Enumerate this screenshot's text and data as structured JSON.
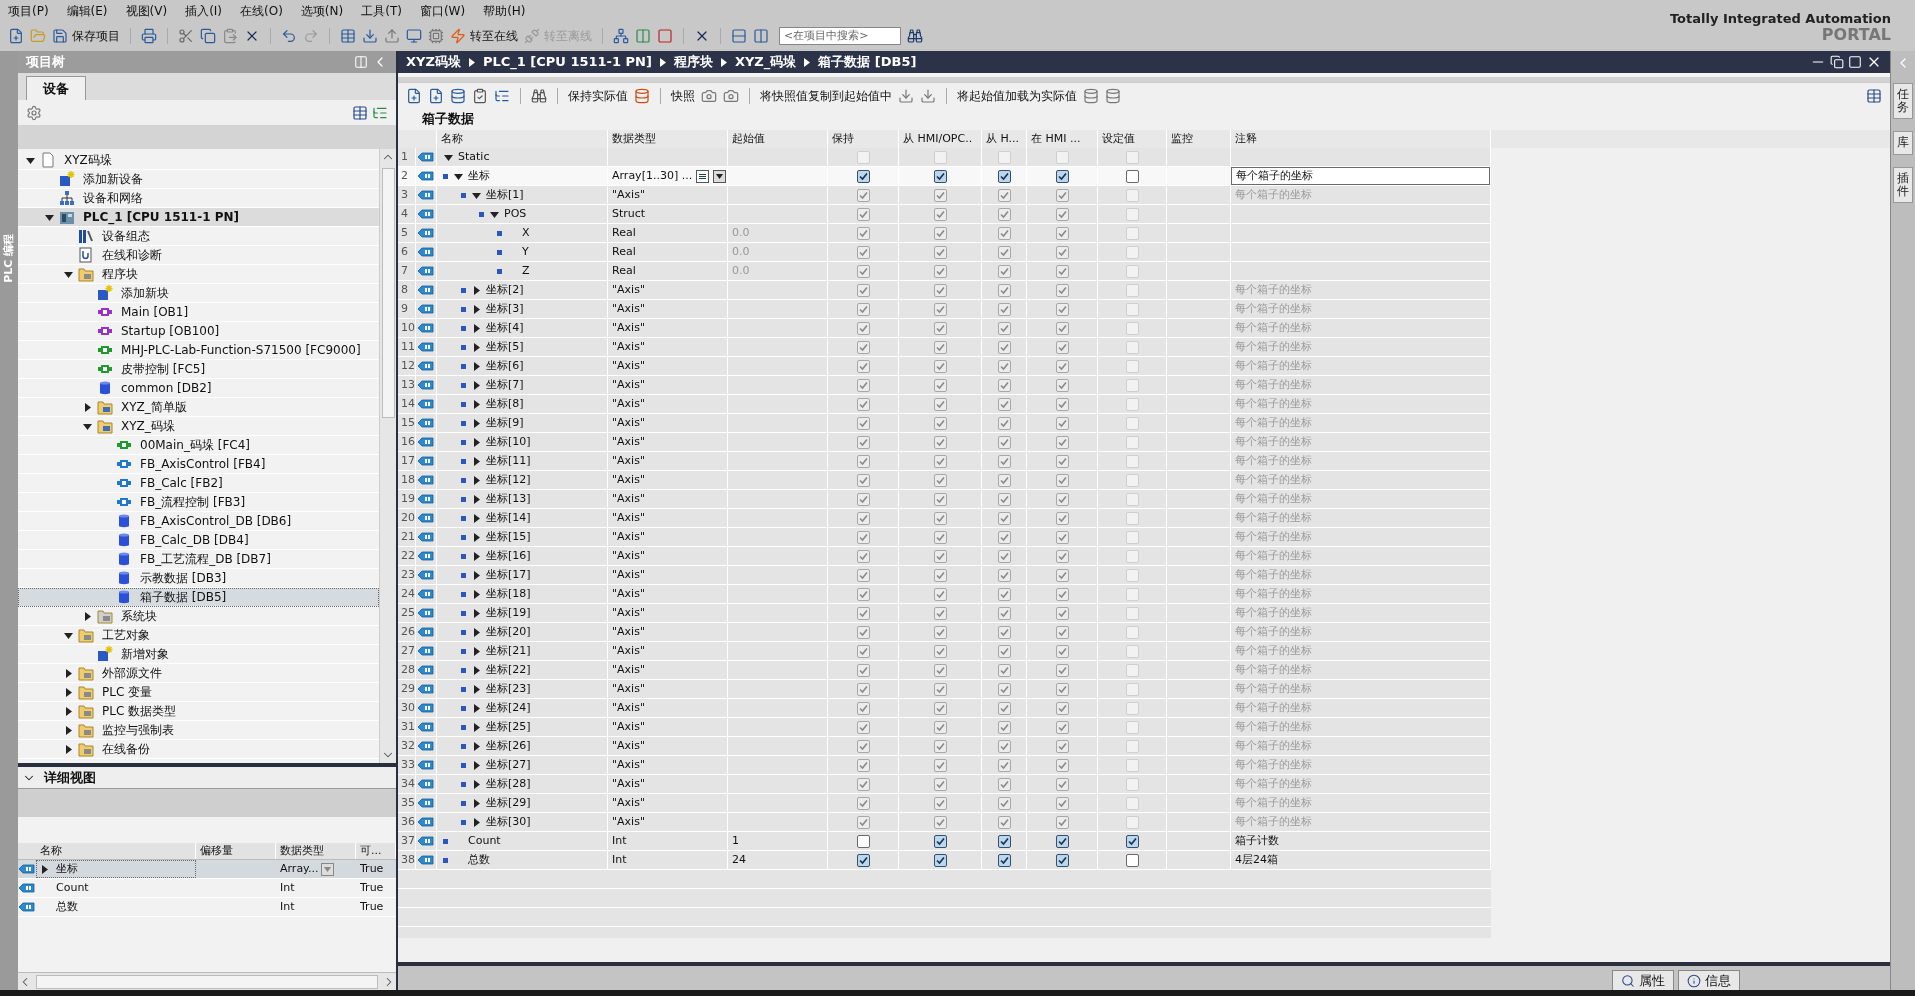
{
  "menu": [
    "项目(P)",
    "编辑(E)",
    "视图(V)",
    "插入(I)",
    "在线(O)",
    "选项(N)",
    "工具(T)",
    "窗口(W)",
    "帮助(H)"
  ],
  "toolbar": {
    "save_label": "保存项目",
    "go_online": {
      "label": "转至在线",
      "disabled": false
    },
    "go_offline": {
      "label": "转至离线",
      "disabled": true
    },
    "search_placeholder": "<在项目中搜索>"
  },
  "brand": {
    "line1": "Totally Integrated Automation",
    "line2": "PORTAL"
  },
  "left_strip": "PLC 编程",
  "project_tree": {
    "title": "项目树",
    "tab": "设备",
    "items": [
      {
        "label": "XYZ码垛",
        "kind": "doc",
        "expanded": true,
        "selected": false,
        "active": false,
        "children": [
          {
            "label": "添加新设备",
            "kind": "add",
            "selected": false,
            "active": false
          },
          {
            "label": "设备和网络",
            "kind": "network",
            "selected": false,
            "active": false
          },
          {
            "label": "PLC_1 [CPU 1511-1 PN]",
            "kind": "plc",
            "expanded": true,
            "selected": false,
            "active": true,
            "children": [
              {
                "label": "设备组态",
                "kind": "config",
                "selected": false,
                "active": false
              },
              {
                "label": "在线和诊断",
                "kind": "diag",
                "selected": false,
                "active": false
              },
              {
                "label": "程序块",
                "kind": "folder",
                "expanded": true,
                "selected": false,
                "active": false,
                "children": [
                  {
                    "label": "添加新块",
                    "kind": "add",
                    "selected": false,
                    "active": false
                  },
                  {
                    "label": "Main [OB1]",
                    "kind": "ob",
                    "selected": false,
                    "active": false
                  },
                  {
                    "label": "Startup [OB100]",
                    "kind": "ob",
                    "selected": false,
                    "active": false
                  },
                  {
                    "label": "MHJ-PLC-Lab-Function-S71500 [FC9000]",
                    "kind": "fc",
                    "selected": false,
                    "active": false
                  },
                  {
                    "label": "皮带控制 [FC5]",
                    "kind": "fc",
                    "selected": false,
                    "active": false
                  },
                  {
                    "label": "common [DB2]",
                    "kind": "db",
                    "selected": false,
                    "active": false
                  },
                  {
                    "label": "XYZ_简单版",
                    "kind": "group",
                    "expanded": false,
                    "selected": false,
                    "active": false
                  },
                  {
                    "label": "XYZ_码垛",
                    "kind": "group",
                    "expanded": true,
                    "selected": false,
                    "active": false,
                    "children": [
                      {
                        "label": "00Main_码垛 [FC4]",
                        "kind": "fc",
                        "selected": false,
                        "active": false
                      },
                      {
                        "label": "FB_AxisControl [FB4]",
                        "kind": "fb",
                        "selected": false,
                        "active": false
                      },
                      {
                        "label": "FB_Calc [FB2]",
                        "kind": "fb",
                        "selected": false,
                        "active": false
                      },
                      {
                        "label": "FB_流程控制 [FB3]",
                        "kind": "fb",
                        "selected": false,
                        "active": false
                      },
                      {
                        "label": "FB_AxisControl_DB [DB6]",
                        "kind": "db",
                        "selected": false,
                        "active": false
                      },
                      {
                        "label": "FB_Calc_DB [DB4]",
                        "kind": "db",
                        "selected": false,
                        "active": false
                      },
                      {
                        "label": "FB_工艺流程_DB [DB7]",
                        "kind": "db",
                        "selected": false,
                        "active": false
                      },
                      {
                        "label": "示教数据 [DB3]",
                        "kind": "db",
                        "selected": false,
                        "active": false
                      },
                      {
                        "label": "箱子数据 [DB5]",
                        "kind": "db",
                        "selected": true,
                        "active": false
                      }
                    ]
                  },
                  {
                    "label": "系统块",
                    "kind": "sysfolder",
                    "expanded": false,
                    "selected": false,
                    "active": false
                  }
                ]
              },
              {
                "label": "工艺对象",
                "kind": "folder",
                "expanded": true,
                "selected": false,
                "active": false,
                "children": [
                  {
                    "label": "新增对象",
                    "kind": "add",
                    "selected": false,
                    "active": false
                  }
                ]
              },
              {
                "label": "外部源文件",
                "kind": "folder",
                "expanded": false,
                "selected": false,
                "active": false
              },
              {
                "label": "PLC 变量",
                "kind": "folder",
                "expanded": false,
                "selected": false,
                "active": false
              },
              {
                "label": "PLC 数据类型",
                "kind": "folder",
                "expanded": false,
                "selected": false,
                "active": false
              },
              {
                "label": "监控与强制表",
                "kind": "folder",
                "expanded": false,
                "selected": false,
                "active": false
              },
              {
                "label": "在线备份",
                "kind": "folder",
                "expanded": false,
                "selected": false,
                "active": false
              }
            ]
          }
        ]
      }
    ]
  },
  "detail_view": {
    "title": "详细视图",
    "columns": [
      "名称",
      "偏移量",
      "数据类型",
      "可..."
    ],
    "rows": [
      {
        "name": "坐标",
        "type": "Array...",
        "accessible": "True",
        "expanded": false,
        "selected": true
      },
      {
        "name": "Count",
        "type": "Int",
        "accessible": "True",
        "selected": false
      },
      {
        "name": "总数",
        "type": "Int",
        "accessible": "True",
        "selected": false
      }
    ]
  },
  "breadcrumb": [
    "XYZ码垛",
    "PLC_1 [CPU 1511-1 PN]",
    "程序块",
    "XYZ_码垛",
    "箱子数据 [DB5]"
  ],
  "editor_toolbar": {
    "keep_actual": "保持实际值",
    "snapshot": "快照",
    "copy_snapshot": "将快照值复制到起始值中",
    "load_start": "将起始值加载为实际值"
  },
  "table": {
    "title": "箱子数据",
    "columns": [
      "名称",
      "数据类型",
      "起始值",
      "保持",
      "从 HMI/OPC..",
      "从 H...",
      "在 HMI ...",
      "设定值",
      "监控",
      "注释"
    ],
    "rows": [
      {
        "no": "1",
        "name": "Static",
        "expanded": true,
        "editable": false,
        "selected": false,
        "checks": [
          false,
          false,
          false,
          false,
          false
        ],
        "children": [
          {
            "no": "2",
            "name": "坐标",
            "type": "Array[1..30] ...",
            "expanded": true,
            "editable": true,
            "selected": true,
            "checks": [
              true,
              true,
              true,
              true,
              false
            ],
            "comment": "每个箱子的坐标",
            "children": [
              {
                "no": "3",
                "name": "坐标[1]",
                "type": "\"Axis\"",
                "expanded": true,
                "editable": false,
                "selected": false,
                "checks": [
                  true,
                  true,
                  true,
                  true,
                  false
                ],
                "comment": "每个箱子的坐标",
                "children": [
                  {
                    "no": "4",
                    "name": "POS",
                    "type": "Struct",
                    "expanded": true,
                    "editable": false,
                    "selected": false,
                    "checks": [
                      true,
                      true,
                      true,
                      true,
                      false
                    ],
                    "children": [
                      {
                        "no": "5",
                        "name": "X",
                        "type": "Real",
                        "start": "0.0",
                        "editable": false,
                        "selected": false,
                        "checks": [
                          true,
                          true,
                          true,
                          true,
                          false
                        ]
                      },
                      {
                        "no": "6",
                        "name": "Y",
                        "type": "Real",
                        "start": "0.0",
                        "editable": false,
                        "selected": false,
                        "checks": [
                          true,
                          true,
                          true,
                          true,
                          false
                        ]
                      },
                      {
                        "no": "7",
                        "name": "Z",
                        "type": "Real",
                        "start": "0.0",
                        "editable": false,
                        "selected": false,
                        "checks": [
                          true,
                          true,
                          true,
                          true,
                          false
                        ]
                      }
                    ]
                  }
                ]
              },
              {
                "no": "8",
                "name": "坐标[2]",
                "type": "\"Axis\"",
                "expanded": false,
                "editable": false,
                "selected": false,
                "checks": [
                  true,
                  true,
                  true,
                  true,
                  false
                ],
                "comment": "每个箱子的坐标"
              },
              {
                "no": "9",
                "name": "坐标[3]",
                "type": "\"Axis\"",
                "expanded": false,
                "editable": false,
                "selected": false,
                "checks": [
                  true,
                  true,
                  true,
                  true,
                  false
                ],
                "comment": "每个箱子的坐标"
              },
              {
                "no": "10",
                "name": "坐标[4]",
                "type": "\"Axis\"",
                "expanded": false,
                "editable": false,
                "selected": false,
                "checks": [
                  true,
                  true,
                  true,
                  true,
                  false
                ],
                "comment": "每个箱子的坐标"
              },
              {
                "no": "11",
                "name": "坐标[5]",
                "type": "\"Axis\"",
                "expanded": false,
                "editable": false,
                "selected": false,
                "checks": [
                  true,
                  true,
                  true,
                  true,
                  false
                ],
                "comment": "每个箱子的坐标"
              },
              {
                "no": "12",
                "name": "坐标[6]",
                "type": "\"Axis\"",
                "expanded": false,
                "editable": false,
                "selected": false,
                "checks": [
                  true,
                  true,
                  true,
                  true,
                  false
                ],
                "comment": "每个箱子的坐标"
              },
              {
                "no": "13",
                "name": "坐标[7]",
                "type": "\"Axis\"",
                "expanded": false,
                "editable": false,
                "selected": false,
                "checks": [
                  true,
                  true,
                  true,
                  true,
                  false
                ],
                "comment": "每个箱子的坐标"
              },
              {
                "no": "14",
                "name": "坐标[8]",
                "type": "\"Axis\"",
                "expanded": false,
                "editable": false,
                "selected": false,
                "checks": [
                  true,
                  true,
                  true,
                  true,
                  false
                ],
                "comment": "每个箱子的坐标"
              },
              {
                "no": "15",
                "name": "坐标[9]",
                "type": "\"Axis\"",
                "expanded": false,
                "editable": false,
                "selected": false,
                "checks": [
                  true,
                  true,
                  true,
                  true,
                  false
                ],
                "comment": "每个箱子的坐标"
              },
              {
                "no": "16",
                "name": "坐标[10]",
                "type": "\"Axis\"",
                "expanded": false,
                "editable": false,
                "selected": false,
                "checks": [
                  true,
                  true,
                  true,
                  true,
                  false
                ],
                "comment": "每个箱子的坐标"
              },
              {
                "no": "17",
                "name": "坐标[11]",
                "type": "\"Axis\"",
                "expanded": false,
                "editable": false,
                "selected": false,
                "checks": [
                  true,
                  true,
                  true,
                  true,
                  false
                ],
                "comment": "每个箱子的坐标"
              },
              {
                "no": "18",
                "name": "坐标[12]",
                "type": "\"Axis\"",
                "expanded": false,
                "editable": false,
                "selected": false,
                "checks": [
                  true,
                  true,
                  true,
                  true,
                  false
                ],
                "comment": "每个箱子的坐标"
              },
              {
                "no": "19",
                "name": "坐标[13]",
                "type": "\"Axis\"",
                "expanded": false,
                "editable": false,
                "selected": false,
                "checks": [
                  true,
                  true,
                  true,
                  true,
                  false
                ],
                "comment": "每个箱子的坐标"
              },
              {
                "no": "20",
                "name": "坐标[14]",
                "type": "\"Axis\"",
                "expanded": false,
                "editable": false,
                "selected": false,
                "checks": [
                  true,
                  true,
                  true,
                  true,
                  false
                ],
                "comment": "每个箱子的坐标"
              },
              {
                "no": "21",
                "name": "坐标[15]",
                "type": "\"Axis\"",
                "expanded": false,
                "editable": false,
                "selected": false,
                "checks": [
                  true,
                  true,
                  true,
                  true,
                  false
                ],
                "comment": "每个箱子的坐标"
              },
              {
                "no": "22",
                "name": "坐标[16]",
                "type": "\"Axis\"",
                "expanded": false,
                "editable": false,
                "selected": false,
                "checks": [
                  true,
                  true,
                  true,
                  true,
                  false
                ],
                "comment": "每个箱子的坐标"
              },
              {
                "no": "23",
                "name": "坐标[17]",
                "type": "\"Axis\"",
                "expanded": false,
                "editable": false,
                "selected": false,
                "checks": [
                  true,
                  true,
                  true,
                  true,
                  false
                ],
                "comment": "每个箱子的坐标"
              },
              {
                "no": "24",
                "name": "坐标[18]",
                "type": "\"Axis\"",
                "expanded": false,
                "editable": false,
                "selected": false,
                "checks": [
                  true,
                  true,
                  true,
                  true,
                  false
                ],
                "comment": "每个箱子的坐标"
              },
              {
                "no": "25",
                "name": "坐标[19]",
                "type": "\"Axis\"",
                "expanded": false,
                "editable": false,
                "selected": false,
                "checks": [
                  true,
                  true,
                  true,
                  true,
                  false
                ],
                "comment": "每个箱子的坐标"
              },
              {
                "no": "26",
                "name": "坐标[20]",
                "type": "\"Axis\"",
                "expanded": false,
                "editable": false,
                "selected": false,
                "checks": [
                  true,
                  true,
                  true,
                  true,
                  false
                ],
                "comment": "每个箱子的坐标"
              },
              {
                "no": "27",
                "name": "坐标[21]",
                "type": "\"Axis\"",
                "expanded": false,
                "editable": false,
                "selected": false,
                "checks": [
                  true,
                  true,
                  true,
                  true,
                  false
                ],
                "comment": "每个箱子的坐标"
              },
              {
                "no": "28",
                "name": "坐标[22]",
                "type": "\"Axis\"",
                "expanded": false,
                "editable": false,
                "selected": false,
                "checks": [
                  true,
                  true,
                  true,
                  true,
                  false
                ],
                "comment": "每个箱子的坐标"
              },
              {
                "no": "29",
                "name": "坐标[23]",
                "type": "\"Axis\"",
                "expanded": false,
                "editable": false,
                "selected": false,
                "checks": [
                  true,
                  true,
                  true,
                  true,
                  false
                ],
                "comment": "每个箱子的坐标"
              },
              {
                "no": "30",
                "name": "坐标[24]",
                "type": "\"Axis\"",
                "expanded": false,
                "editable": false,
                "selected": false,
                "checks": [
                  true,
                  true,
                  true,
                  true,
                  false
                ],
                "comment": "每个箱子的坐标"
              },
              {
                "no": "31",
                "name": "坐标[25]",
                "type": "\"Axis\"",
                "expanded": false,
                "editable": false,
                "selected": false,
                "checks": [
                  true,
                  true,
                  true,
                  true,
                  false
                ],
                "comment": "每个箱子的坐标"
              },
              {
                "no": "32",
                "name": "坐标[26]",
                "type": "\"Axis\"",
                "expanded": false,
                "editable": false,
                "selected": false,
                "checks": [
                  true,
                  true,
                  true,
                  true,
                  false
                ],
                "comment": "每个箱子的坐标"
              },
              {
                "no": "33",
                "name": "坐标[27]",
                "type": "\"Axis\"",
                "expanded": false,
                "editable": false,
                "selected": false,
                "checks": [
                  true,
                  true,
                  true,
                  true,
                  false
                ],
                "comment": "每个箱子的坐标"
              },
              {
                "no": "34",
                "name": "坐标[28]",
                "type": "\"Axis\"",
                "expanded": false,
                "editable": false,
                "selected": false,
                "checks": [
                  true,
                  true,
                  true,
                  true,
                  false
                ],
                "comment": "每个箱子的坐标"
              },
              {
                "no": "35",
                "name": "坐标[29]",
                "type": "\"Axis\"",
                "expanded": false,
                "editable": false,
                "selected": false,
                "checks": [
                  true,
                  true,
                  true,
                  true,
                  false
                ],
                "comment": "每个箱子的坐标"
              },
              {
                "no": "36",
                "name": "坐标[30]",
                "type": "\"Axis\"",
                "expanded": false,
                "editable": false,
                "selected": false,
                "checks": [
                  true,
                  true,
                  true,
                  true,
                  false
                ],
                "comment": "每个箱子的坐标"
              }
            ]
          },
          {
            "no": "37",
            "name": "Count",
            "type": "Int",
            "start": "1",
            "editable": true,
            "selected": false,
            "checks": [
              false,
              true,
              true,
              true,
              true
            ],
            "comment": "箱子计数"
          },
          {
            "no": "38",
            "name": "总数",
            "type": "Int",
            "start": "24",
            "editable": true,
            "selected": false,
            "checks": [
              true,
              true,
              true,
              true,
              false
            ],
            "comment": "4层24箱"
          }
        ]
      }
    ]
  },
  "right_tabs": [
    "任务",
    "库",
    "插件"
  ],
  "status_tabs": [
    {
      "label": "属性"
    },
    {
      "label": "信息"
    }
  ]
}
